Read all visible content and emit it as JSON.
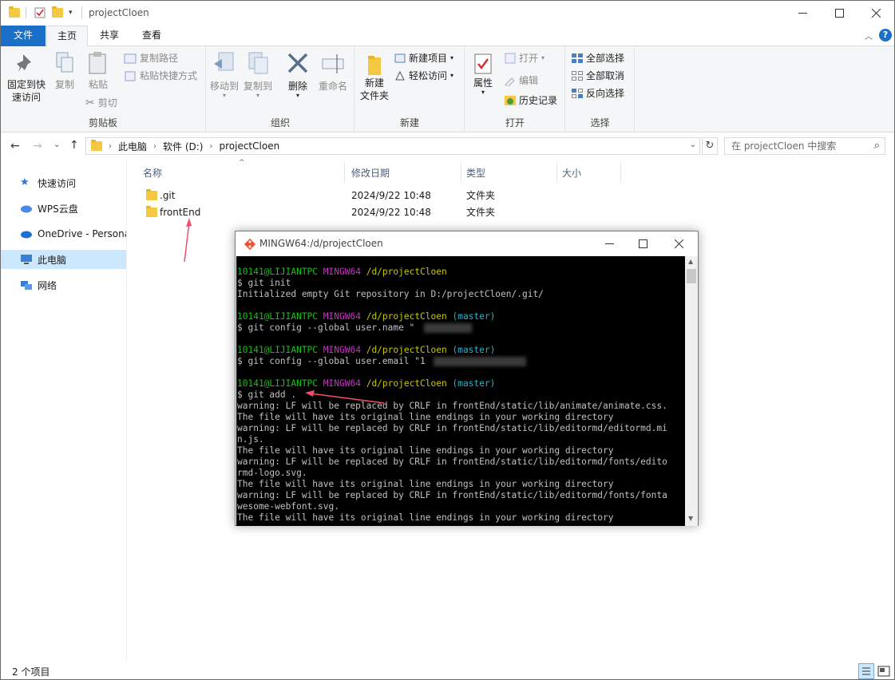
{
  "explorer": {
    "title": "projectCloen",
    "tabs": [
      "文件",
      "主页",
      "共享",
      "查看"
    ],
    "ribbon": {
      "clipboard": {
        "group": "剪贴板",
        "pin": "固定到快速访问",
        "copy": "复制",
        "paste": "粘贴",
        "copy_path": "复制路径",
        "paste_shortcut": "粘贴快捷方式",
        "cut": "剪切"
      },
      "organize": {
        "group": "组织",
        "move_to": "移动到",
        "copy_to": "复制到",
        "delete": "删除",
        "rename": "重命名"
      },
      "new": {
        "group": "新建",
        "new_folder_1": "新建",
        "new_folder_2": "文件夹",
        "new_item": "新建项目",
        "easy_access": "轻松访问"
      },
      "open": {
        "group": "打开",
        "properties": "属性",
        "open": "打开",
        "edit": "编辑",
        "history": "历史记录"
      },
      "select": {
        "group": "选择",
        "select_all": "全部选择",
        "select_none": "全部取消",
        "invert": "反向选择"
      }
    },
    "address": {
      "crumbs": [
        "此电脑",
        "软件 (D:)",
        "projectCloen"
      ],
      "search_placeholder": "在 projectCloen 中搜索"
    },
    "nav": [
      "快速访问",
      "WPS云盘",
      "OneDrive - Persona",
      "此电脑",
      "网络"
    ],
    "columns": {
      "name": "名称",
      "date": "修改日期",
      "type": "类型",
      "size": "大小"
    },
    "files": [
      {
        "name": ".git",
        "date": "2024/9/22 10:48",
        "type": "文件夹"
      },
      {
        "name": "frontEnd",
        "date": "2024/9/22 10:48",
        "type": "文件夹"
      }
    ],
    "status": "2 个项目"
  },
  "terminal": {
    "title": "MINGW64:/d/projectCloen",
    "lines": [
      [
        {
          "t": "10141@LIJIANTPC",
          "c": "g"
        },
        {
          "t": " "
        },
        {
          "t": "MINGW64",
          "c": "m"
        },
        {
          "t": " "
        },
        {
          "t": "/d/projectCloen",
          "c": "y"
        }
      ],
      [
        {
          "t": "$ git init"
        }
      ],
      [
        {
          "t": "Initialized empty Git repository in D:/projectCloen/.git/"
        }
      ],
      [
        {
          "t": ""
        }
      ],
      [
        {
          "t": "10141@LIJIANTPC",
          "c": "g"
        },
        {
          "t": " "
        },
        {
          "t": "MINGW64",
          "c": "m"
        },
        {
          "t": " "
        },
        {
          "t": "/d/projectCloen",
          "c": "y"
        },
        {
          "t": " "
        },
        {
          "t": "(master)",
          "c": "c"
        }
      ],
      [
        {
          "t": "$ git config --global user.name \""
        }
      ],
      [
        {
          "t": ""
        }
      ],
      [
        {
          "t": "10141@LIJIANTPC",
          "c": "g"
        },
        {
          "t": " "
        },
        {
          "t": "MINGW64",
          "c": "m"
        },
        {
          "t": " "
        },
        {
          "t": "/d/projectCloen",
          "c": "y"
        },
        {
          "t": " "
        },
        {
          "t": "(master)",
          "c": "c"
        }
      ],
      [
        {
          "t": "$ git config --global user.email \"1"
        }
      ],
      [
        {
          "t": ""
        }
      ],
      [
        {
          "t": "10141@LIJIANTPC",
          "c": "g"
        },
        {
          "t": " "
        },
        {
          "t": "MINGW64",
          "c": "m"
        },
        {
          "t": " "
        },
        {
          "t": "/d/projectCloen",
          "c": "y"
        },
        {
          "t": " "
        },
        {
          "t": "(master)",
          "c": "c"
        }
      ],
      [
        {
          "t": "$ git add ."
        }
      ],
      [
        {
          "t": "warning: LF will be replaced by CRLF in frontEnd/static/lib/animate/animate.css."
        }
      ],
      [
        {
          "t": "The file will have its original line endings in your working directory"
        }
      ],
      [
        {
          "t": "warning: LF will be replaced by CRLF in frontEnd/static/lib/editormd/editormd.mi"
        }
      ],
      [
        {
          "t": "n.js."
        }
      ],
      [
        {
          "t": "The file will have its original line endings in your working directory"
        }
      ],
      [
        {
          "t": "warning: LF will be replaced by CRLF in frontEnd/static/lib/editormd/fonts/edito"
        }
      ],
      [
        {
          "t": "rmd-logo.svg."
        }
      ],
      [
        {
          "t": "The file will have its original line endings in your working directory"
        }
      ],
      [
        {
          "t": "warning: LF will be replaced by CRLF in frontEnd/static/lib/editormd/fonts/fonta"
        }
      ],
      [
        {
          "t": "wesome-webfont.svg."
        }
      ],
      [
        {
          "t": "The file will have its original line endings in your working directory"
        }
      ]
    ]
  },
  "colors": {
    "accent": "#1a6fc9",
    "selected_nav": "#cce8ff",
    "annotation_arrow": "#f0506e"
  }
}
